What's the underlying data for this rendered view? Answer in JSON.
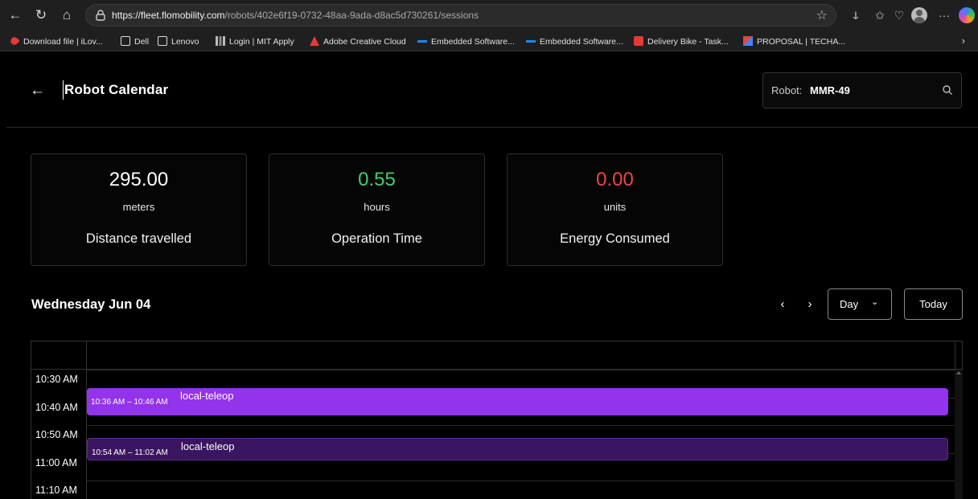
{
  "browser": {
    "url_host": "https://fleet.flomobility.com",
    "url_path": "/robots/402e6f19-0732-48aa-9ada-d8ac5d730261/sessions",
    "bookmarks": [
      "Download file | iLov...",
      "Dell",
      "Lenovo",
      "Login | MIT Apply",
      "Adobe Creative Cloud",
      "Embedded Software...",
      "Embedded Software...",
      "Delivery Bike - Task...",
      "PROPOSAL | TECHA..."
    ]
  },
  "header": {
    "title": "Robot Calendar",
    "robot_label": "Robot:",
    "robot_value": "MMR-49"
  },
  "stats": [
    {
      "value": "295.00",
      "unit": "meters",
      "label": "Distance travelled",
      "color": "#ffffff"
    },
    {
      "value": "0.55",
      "unit": "hours",
      "label": "Operation Time",
      "color": "#3fcf6b"
    },
    {
      "value": "0.00",
      "unit": "units",
      "label": "Energy Consumed",
      "color": "#ef4444"
    }
  ],
  "calendar": {
    "date_title": "Wednesday Jun 04",
    "view": "Day",
    "today_label": "Today",
    "prev_glyph": "‹",
    "next_glyph": "›",
    "time_slots": [
      "10:30 AM",
      "10:40 AM",
      "10:50 AM",
      "11:00 AM",
      "11:10 AM"
    ],
    "events": [
      {
        "time": "10:36 AM – 10:46 AM",
        "title": "local-teleop",
        "color": "#9333ea"
      },
      {
        "time": "10:54 AM – 11:02 AM",
        "title": "local-teleop",
        "color": "#3b1660"
      }
    ]
  }
}
